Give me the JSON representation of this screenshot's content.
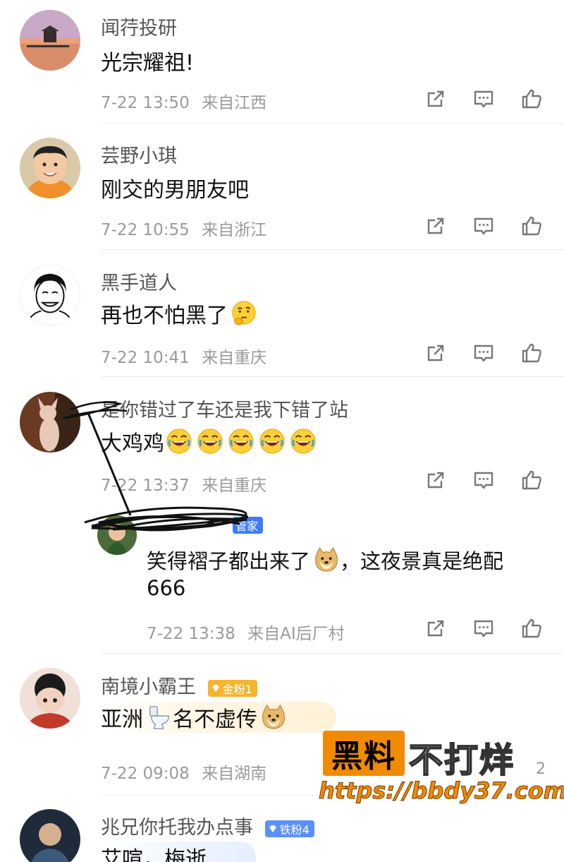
{
  "comments": [
    {
      "username": "闻荇投研",
      "text": "光宗耀祖!",
      "date": "7-22 13:50",
      "location": "来自江西"
    },
    {
      "username": "芸野小琪",
      "text": "刚交的男朋友吧",
      "date": "7-22 10:55",
      "location": "来自浙江"
    },
    {
      "username": "黑手道人",
      "text": "再也不怕黑了",
      "date": "7-22 10:41",
      "location": "来自重庆"
    },
    {
      "username": "是你错过了车还是我下错了站",
      "text": "大鸡鸡",
      "date": "7-22 13:37",
      "location": "来自重庆"
    },
    {
      "username": "南境小霸王",
      "badge": "金粉1",
      "text_a": "亚洲",
      "text_b": "名不虚传",
      "date": "7-22 09:08",
      "location": "来自湖南",
      "count": "2"
    },
    {
      "username": "兆兄你托我办点事",
      "badge": "铁粉4",
      "text": "艾喧，梅逝"
    }
  ],
  "reply": {
    "badge": "管家",
    "text_a": "笑得褶子都出来了",
    "text_b": "，这夜景真是绝配",
    "text_c": "666",
    "date": "7-22 13:38",
    "location": "来自AI后厂村"
  },
  "watermark": {
    "box": "黑料",
    "right": "不打烊",
    "url": "https://bbdy37.com"
  },
  "icons": {
    "share": "share-icon",
    "comment": "comment-icon",
    "like": "thumbs-up-icon"
  },
  "colors": {
    "gold_badge": "#f5b52e",
    "iron_badge": "#5b8ff9",
    "manager_badge": "#3d7bff",
    "watermark_orange": "#f28a00"
  }
}
